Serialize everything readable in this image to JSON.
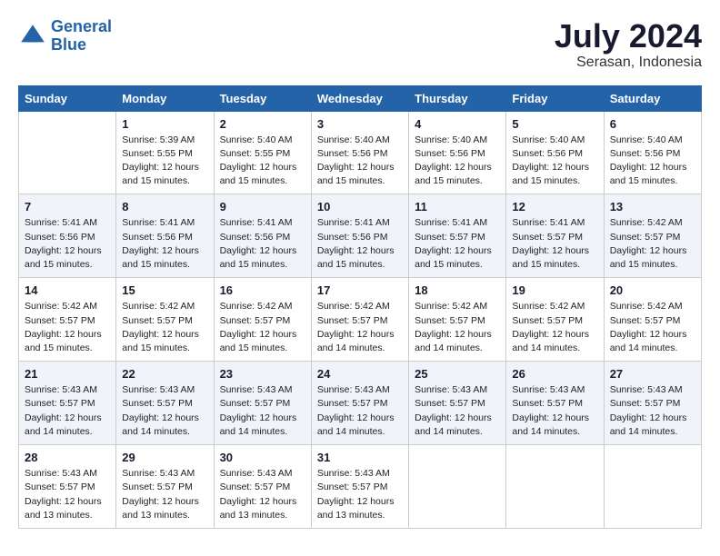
{
  "logo": {
    "line1": "General",
    "line2": "Blue"
  },
  "title": "July 2024",
  "location": "Serasan, Indonesia",
  "days_of_week": [
    "Sunday",
    "Monday",
    "Tuesday",
    "Wednesday",
    "Thursday",
    "Friday",
    "Saturday"
  ],
  "weeks": [
    [
      {
        "day": null
      },
      {
        "day": "1",
        "sunrise": "5:39 AM",
        "sunset": "5:55 PM",
        "daylight": "12 hours and 15 minutes."
      },
      {
        "day": "2",
        "sunrise": "5:40 AM",
        "sunset": "5:55 PM",
        "daylight": "12 hours and 15 minutes."
      },
      {
        "day": "3",
        "sunrise": "5:40 AM",
        "sunset": "5:56 PM",
        "daylight": "12 hours and 15 minutes."
      },
      {
        "day": "4",
        "sunrise": "5:40 AM",
        "sunset": "5:56 PM",
        "daylight": "12 hours and 15 minutes."
      },
      {
        "day": "5",
        "sunrise": "5:40 AM",
        "sunset": "5:56 PM",
        "daylight": "12 hours and 15 minutes."
      },
      {
        "day": "6",
        "sunrise": "5:40 AM",
        "sunset": "5:56 PM",
        "daylight": "12 hours and 15 minutes."
      }
    ],
    [
      {
        "day": "7",
        "sunrise": "5:41 AM",
        "sunset": "5:56 PM",
        "daylight": "12 hours and 15 minutes."
      },
      {
        "day": "8",
        "sunrise": "5:41 AM",
        "sunset": "5:56 PM",
        "daylight": "12 hours and 15 minutes."
      },
      {
        "day": "9",
        "sunrise": "5:41 AM",
        "sunset": "5:56 PM",
        "daylight": "12 hours and 15 minutes."
      },
      {
        "day": "10",
        "sunrise": "5:41 AM",
        "sunset": "5:56 PM",
        "daylight": "12 hours and 15 minutes."
      },
      {
        "day": "11",
        "sunrise": "5:41 AM",
        "sunset": "5:57 PM",
        "daylight": "12 hours and 15 minutes."
      },
      {
        "day": "12",
        "sunrise": "5:41 AM",
        "sunset": "5:57 PM",
        "daylight": "12 hours and 15 minutes."
      },
      {
        "day": "13",
        "sunrise": "5:42 AM",
        "sunset": "5:57 PM",
        "daylight": "12 hours and 15 minutes."
      }
    ],
    [
      {
        "day": "14",
        "sunrise": "5:42 AM",
        "sunset": "5:57 PM",
        "daylight": "12 hours and 15 minutes."
      },
      {
        "day": "15",
        "sunrise": "5:42 AM",
        "sunset": "5:57 PM",
        "daylight": "12 hours and 15 minutes."
      },
      {
        "day": "16",
        "sunrise": "5:42 AM",
        "sunset": "5:57 PM",
        "daylight": "12 hours and 15 minutes."
      },
      {
        "day": "17",
        "sunrise": "5:42 AM",
        "sunset": "5:57 PM",
        "daylight": "12 hours and 14 minutes."
      },
      {
        "day": "18",
        "sunrise": "5:42 AM",
        "sunset": "5:57 PM",
        "daylight": "12 hours and 14 minutes."
      },
      {
        "day": "19",
        "sunrise": "5:42 AM",
        "sunset": "5:57 PM",
        "daylight": "12 hours and 14 minutes."
      },
      {
        "day": "20",
        "sunrise": "5:42 AM",
        "sunset": "5:57 PM",
        "daylight": "12 hours and 14 minutes."
      }
    ],
    [
      {
        "day": "21",
        "sunrise": "5:43 AM",
        "sunset": "5:57 PM",
        "daylight": "12 hours and 14 minutes."
      },
      {
        "day": "22",
        "sunrise": "5:43 AM",
        "sunset": "5:57 PM",
        "daylight": "12 hours and 14 minutes."
      },
      {
        "day": "23",
        "sunrise": "5:43 AM",
        "sunset": "5:57 PM",
        "daylight": "12 hours and 14 minutes."
      },
      {
        "day": "24",
        "sunrise": "5:43 AM",
        "sunset": "5:57 PM",
        "daylight": "12 hours and 14 minutes."
      },
      {
        "day": "25",
        "sunrise": "5:43 AM",
        "sunset": "5:57 PM",
        "daylight": "12 hours and 14 minutes."
      },
      {
        "day": "26",
        "sunrise": "5:43 AM",
        "sunset": "5:57 PM",
        "daylight": "12 hours and 14 minutes."
      },
      {
        "day": "27",
        "sunrise": "5:43 AM",
        "sunset": "5:57 PM",
        "daylight": "12 hours and 14 minutes."
      }
    ],
    [
      {
        "day": "28",
        "sunrise": "5:43 AM",
        "sunset": "5:57 PM",
        "daylight": "12 hours and 13 minutes."
      },
      {
        "day": "29",
        "sunrise": "5:43 AM",
        "sunset": "5:57 PM",
        "daylight": "12 hours and 13 minutes."
      },
      {
        "day": "30",
        "sunrise": "5:43 AM",
        "sunset": "5:57 PM",
        "daylight": "12 hours and 13 minutes."
      },
      {
        "day": "31",
        "sunrise": "5:43 AM",
        "sunset": "5:57 PM",
        "daylight": "12 hours and 13 minutes."
      },
      {
        "day": null
      },
      {
        "day": null
      },
      {
        "day": null
      }
    ]
  ]
}
